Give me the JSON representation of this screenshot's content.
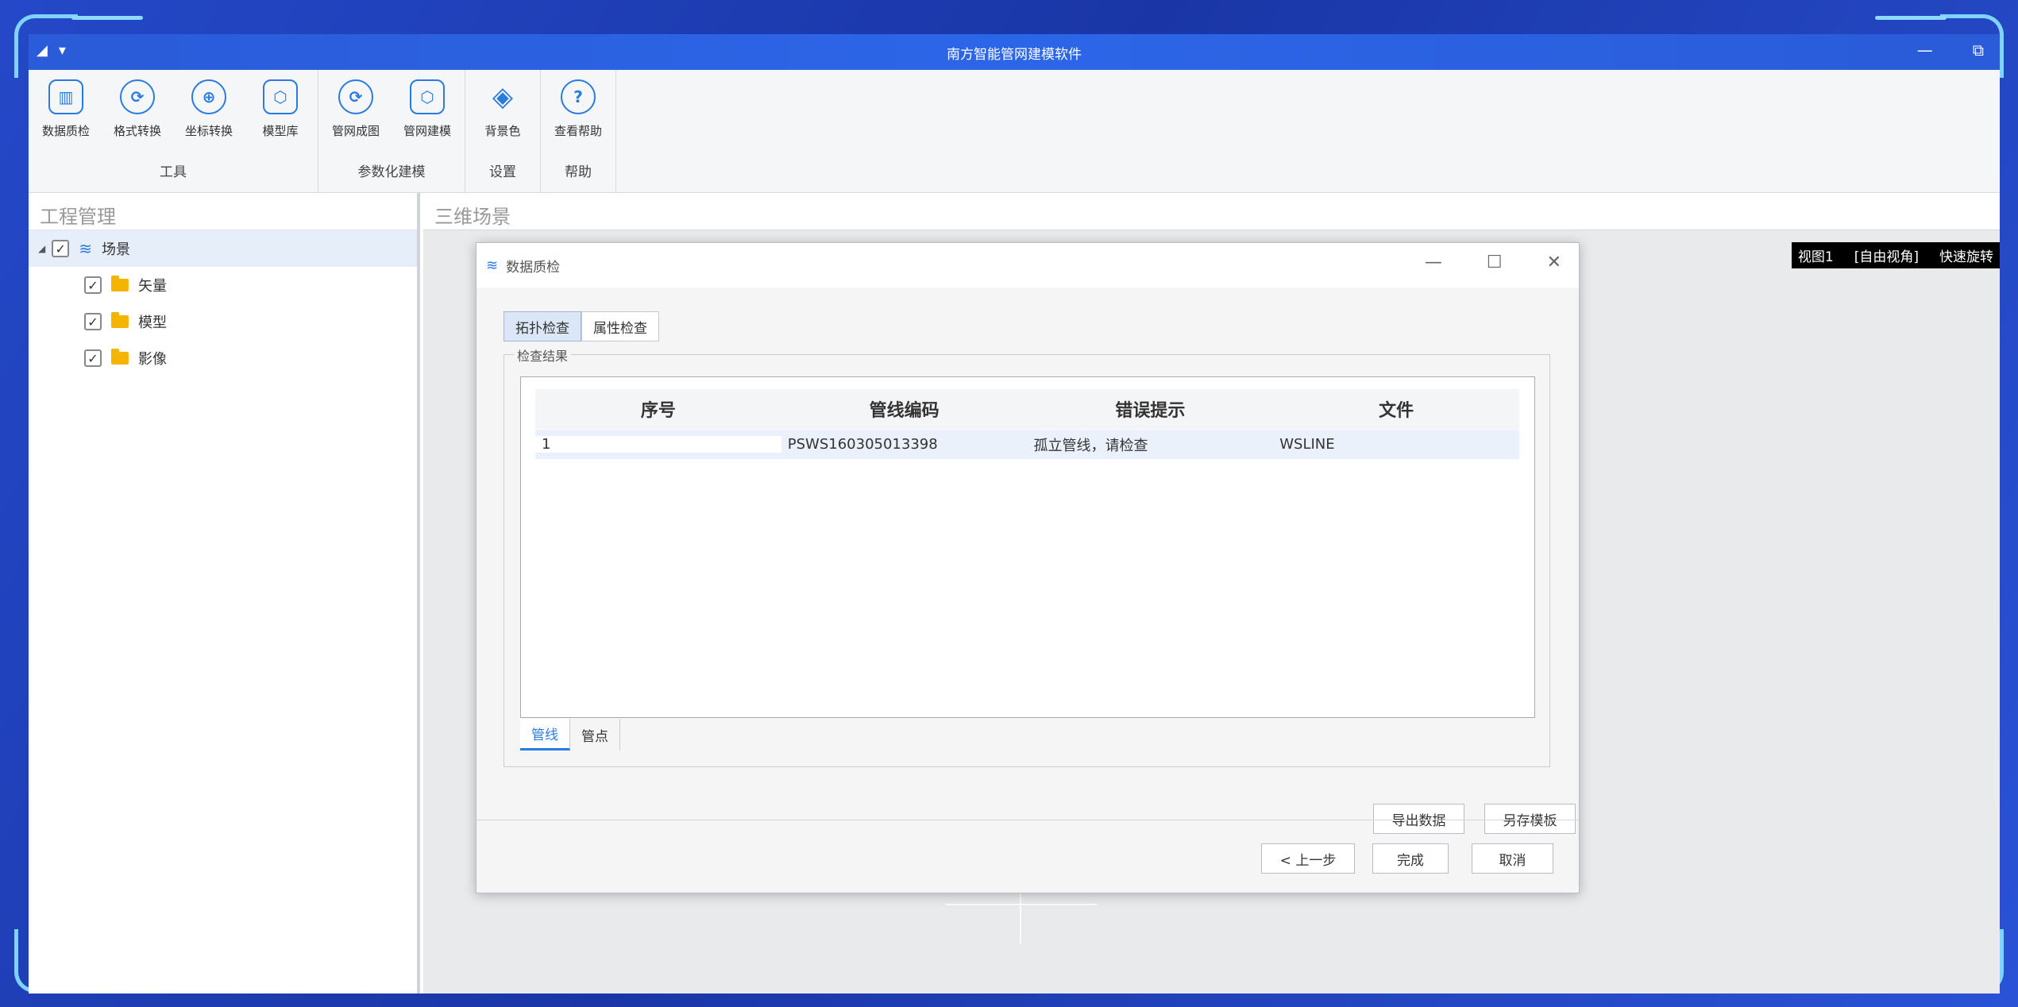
{
  "app": {
    "title": "南方智能管网建模软件",
    "quick_access": [
      "◢",
      "▾"
    ],
    "window_controls": {
      "minimize": "—",
      "restore": "⧉"
    }
  },
  "ribbon": {
    "groups": [
      {
        "name": "工具",
        "buttons": [
          {
            "label": "数据质检",
            "icon": "chart-icon"
          },
          {
            "label": "格式转换",
            "icon": "format-convert-icon"
          },
          {
            "label": "坐标转换",
            "icon": "coordinate-convert-icon"
          },
          {
            "label": "模型库",
            "icon": "model-library-icon"
          }
        ]
      },
      {
        "name": "参数化建模",
        "buttons": [
          {
            "label": "管网成图",
            "icon": "pipe-map-icon"
          },
          {
            "label": "管网建模",
            "icon": "pipe-model-icon"
          }
        ]
      },
      {
        "name": "设置",
        "buttons": [
          {
            "label": "背景色",
            "icon": "paint-bucket-icon"
          }
        ]
      },
      {
        "name": "帮助",
        "buttons": [
          {
            "label": "查看帮助",
            "icon": "help-icon"
          }
        ]
      }
    ]
  },
  "left_panel": {
    "title": "工程管理",
    "tree": [
      {
        "label": "场景",
        "level": 0,
        "checked": true
      },
      {
        "label": "矢量",
        "level": 1,
        "checked": true
      },
      {
        "label": "模型",
        "level": 1,
        "checked": true
      },
      {
        "label": "影像",
        "level": 1,
        "checked": true
      }
    ]
  },
  "scene": {
    "title": "三维场景",
    "viewbar": [
      "视图1",
      "[自由视角]",
      "快速旋转"
    ]
  },
  "dialog": {
    "title": "数据质检",
    "controls": {
      "minimize": "—",
      "maximize": "☐",
      "close": "✕"
    },
    "tabs": [
      "拓扑检查",
      "属性检查"
    ],
    "groupbox_label": "检查结果",
    "columns": [
      "序号",
      "管线编码",
      "错误提示",
      "文件"
    ],
    "rows": [
      {
        "index": "1",
        "code": "PSWS160305013398",
        "error": "孤立管线，请检查",
        "file": "WSLINE"
      }
    ],
    "subtabs": [
      "管线",
      "管点"
    ],
    "export_button": "导出数据",
    "save_template_button": "另存模板",
    "prev_button": "< 上一步",
    "finish_button": "完成",
    "cancel_button": "取消"
  },
  "colors": {
    "accent": "#2a7be0",
    "titlebar": "#2c66e8",
    "frame": "#7fd4ff"
  }
}
